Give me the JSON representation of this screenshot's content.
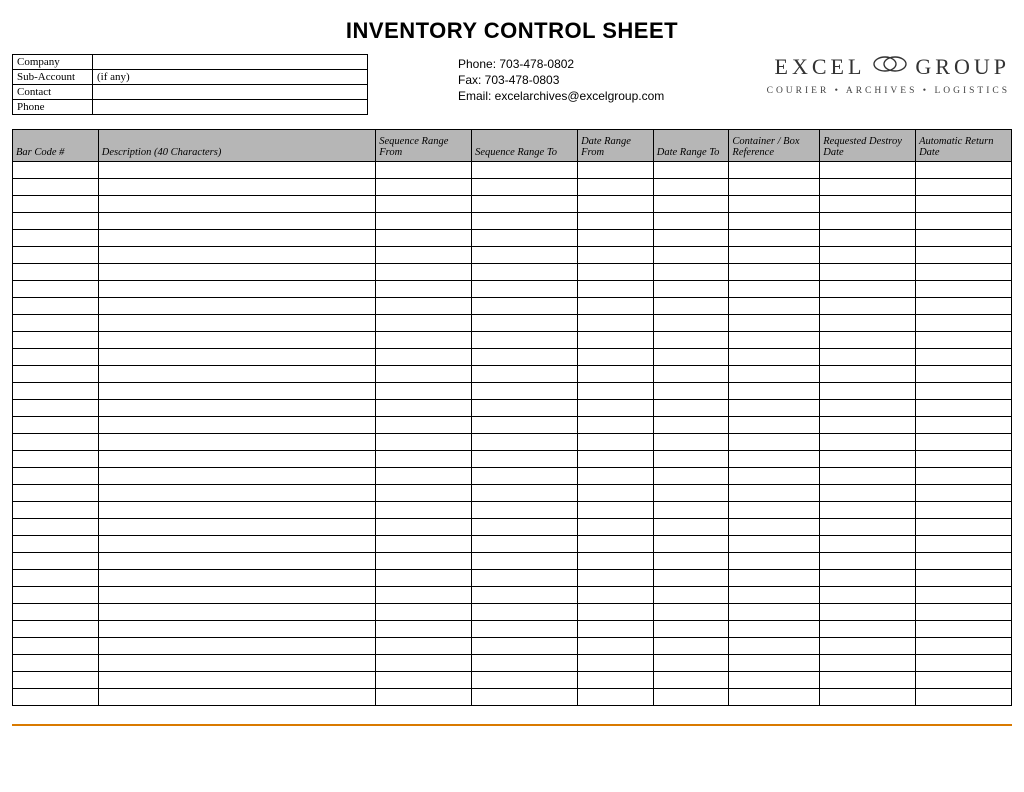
{
  "title": "INVENTORY CONTROL SHEET",
  "info": {
    "rows": [
      {
        "label": "Company",
        "value": ""
      },
      {
        "label": "Sub-Account",
        "value": "(if any)"
      },
      {
        "label": "Contact",
        "value": ""
      },
      {
        "label": "Phone",
        "value": ""
      }
    ]
  },
  "contact": {
    "phone_line": "Phone:  703-478-0802",
    "fax_line": "Fax:  703-478-0803",
    "email_line": "Email:  excelarchives@excelgroup.com"
  },
  "brand": {
    "word1": "EXCEL",
    "word2": "GROUP",
    "tagline": "COURIER • ARCHIVES • LOGISTICS"
  },
  "grid": {
    "columns": [
      "Bar Code #",
      "Description (40 Characters)",
      "Sequence Range From",
      "Sequence Range To",
      "Date Range From",
      "Date Range To",
      "Container / Box Reference",
      "Requested Destroy Date",
      "Automatic Return Date"
    ],
    "row_count": 32
  }
}
